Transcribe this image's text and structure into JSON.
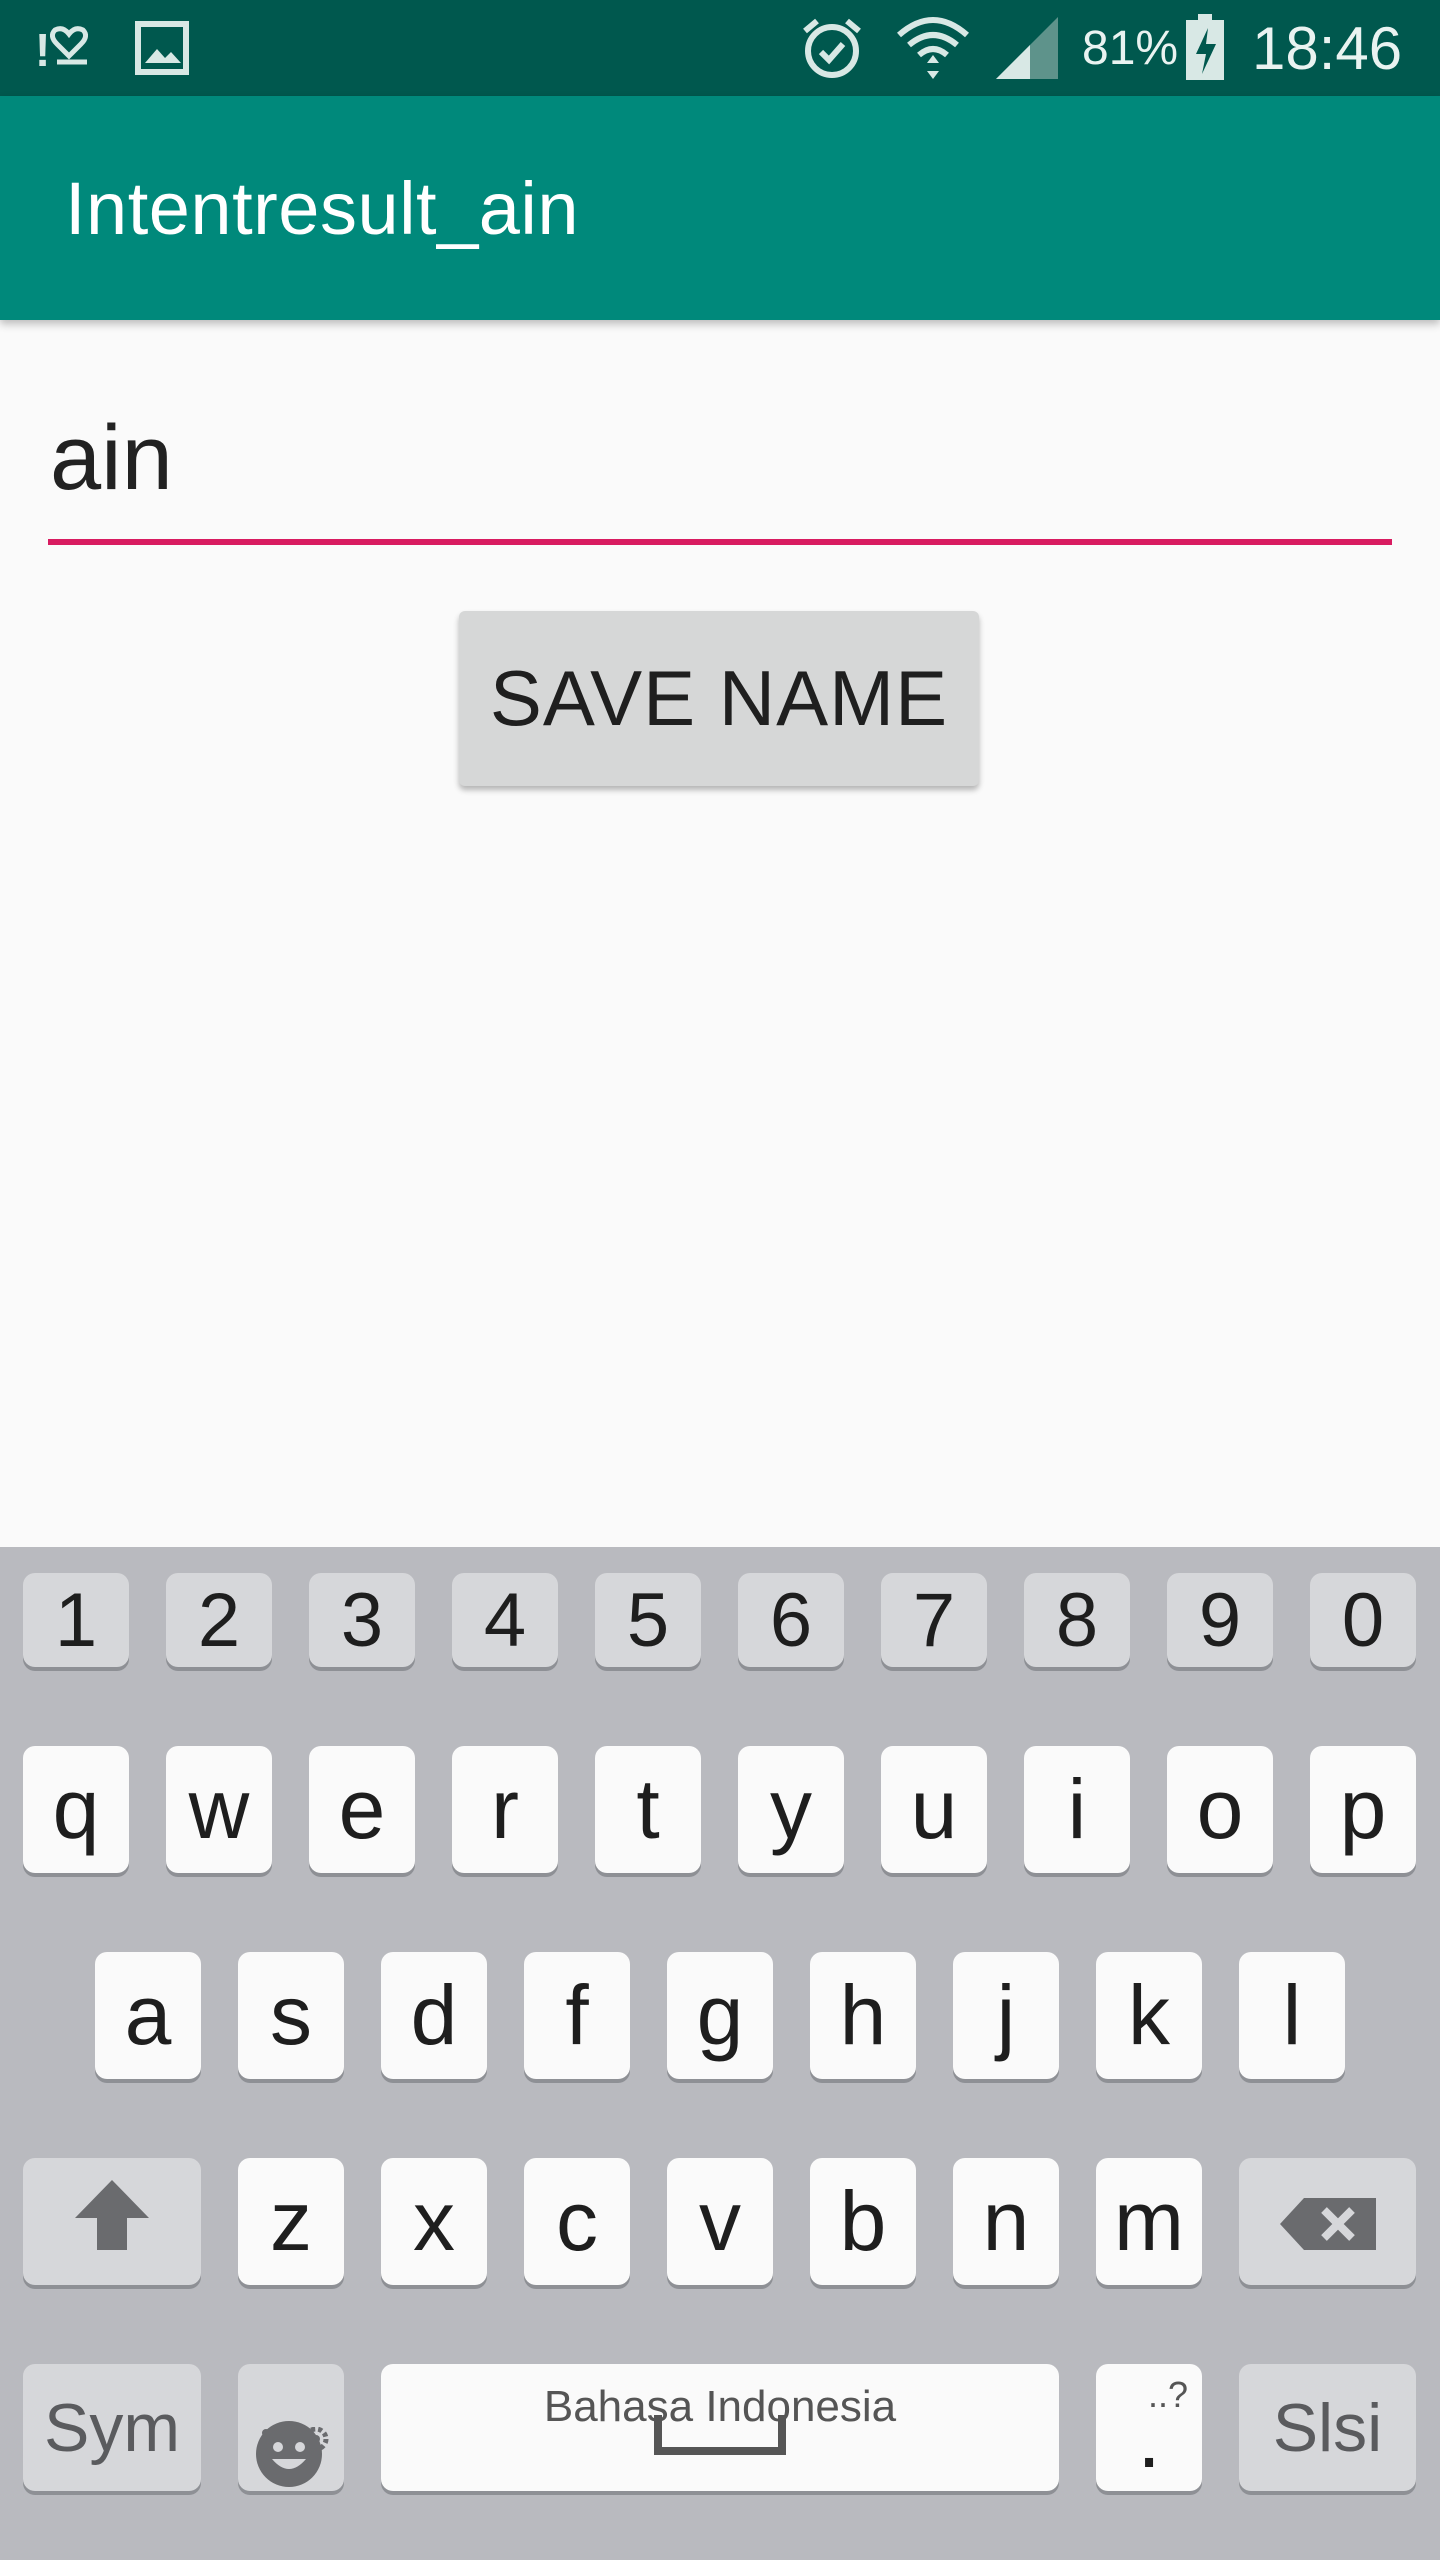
{
  "status_bar": {
    "battery_percent": "81%",
    "time": "18:46",
    "icons": [
      "notification-icon",
      "gallery-icon",
      "alarm-icon",
      "wifi-icon",
      "signal-icon",
      "battery-charging-icon"
    ]
  },
  "app_bar": {
    "title": "Intentresult_ain"
  },
  "form": {
    "name_value": "ain",
    "save_label": "SAVE NAME"
  },
  "keyboard": {
    "number_row": [
      "1",
      "2",
      "3",
      "4",
      "5",
      "6",
      "7",
      "8",
      "9",
      "0"
    ],
    "row1": [
      "q",
      "w",
      "e",
      "r",
      "t",
      "y",
      "u",
      "i",
      "o",
      "p"
    ],
    "row2": [
      "a",
      "s",
      "d",
      "f",
      "g",
      "h",
      "j",
      "k",
      "l"
    ],
    "row3": [
      "z",
      "x",
      "c",
      "v",
      "b",
      "n",
      "m"
    ],
    "sym_label": "Sym",
    "space_label": "Bahasa Indonesia",
    "period_label": ".",
    "period_hint": "..?",
    "send_label": "Slsi",
    "icons": [
      "shift-icon",
      "backspace-icon",
      "emoji-icon",
      "settings-gear-icon",
      "space-icon"
    ]
  },
  "colors": {
    "status_bar": "#00584e",
    "app_bar": "#00897b",
    "accent": "#d81b60",
    "keyboard_bg": "#b9babf"
  }
}
